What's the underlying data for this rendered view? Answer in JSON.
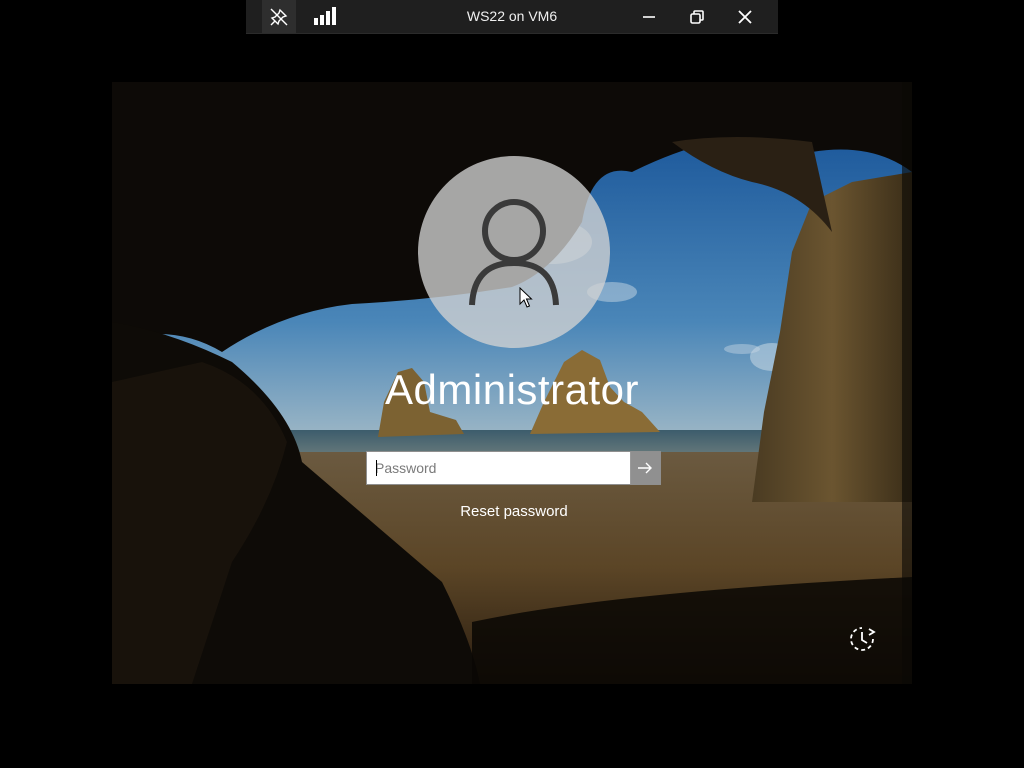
{
  "remote_bar": {
    "title": "WS22 on VM6",
    "icons": [
      "pin-icon",
      "connection-bars-icon",
      "minimize-icon",
      "restore-icon",
      "close-icon"
    ]
  },
  "lock_screen": {
    "username": "Administrator",
    "password": {
      "value": "",
      "placeholder": "Password"
    },
    "submit_icon": "arrow-right-icon",
    "reset_link": "Reset password",
    "ease_of_access_icon": "ease-of-access-icon"
  }
}
